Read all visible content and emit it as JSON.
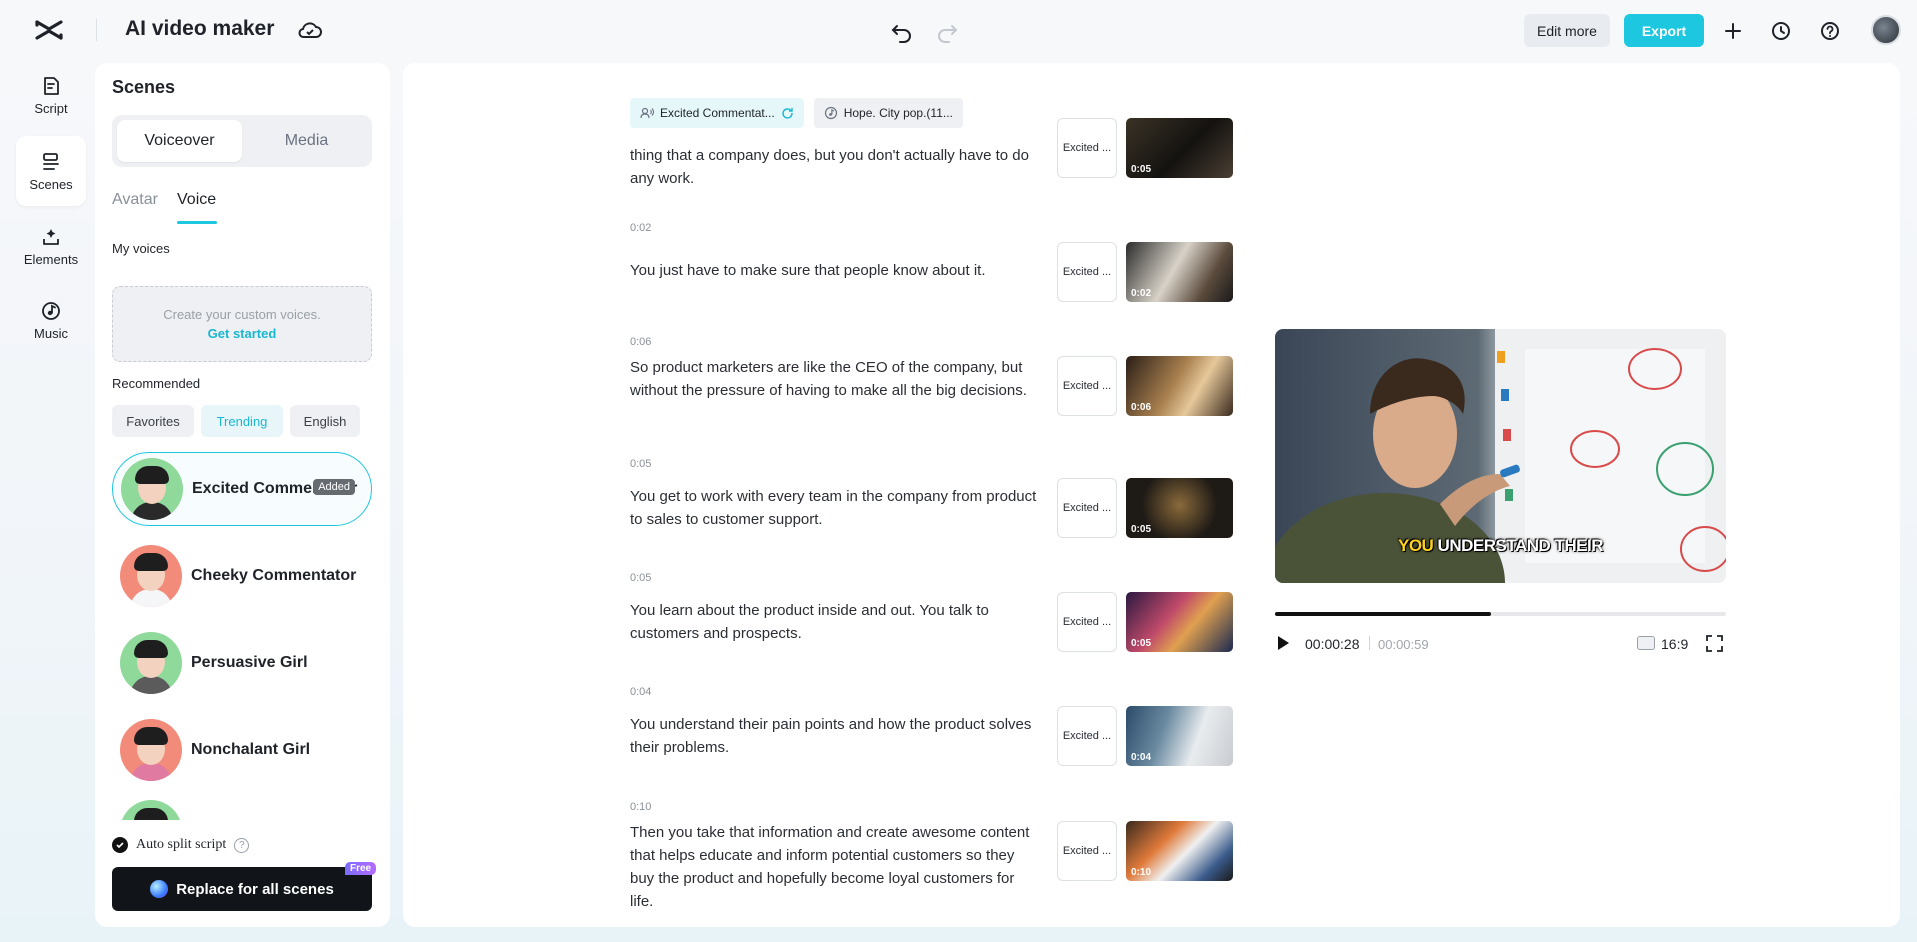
{
  "app": {
    "title": "AI video maker",
    "edit_more": "Edit more",
    "export": "Export",
    "accent": "#1ec7e0"
  },
  "rail": [
    {
      "label": "Script",
      "icon": "script-icon"
    },
    {
      "label": "Scenes",
      "icon": "scenes-icon"
    },
    {
      "label": "Elements",
      "icon": "elements-icon"
    },
    {
      "label": "Music",
      "icon": "music-icon"
    }
  ],
  "scenes_panel": {
    "title": "Scenes",
    "segment": [
      "Voiceover",
      "Media"
    ],
    "tabs": [
      "Avatar",
      "Voice"
    ],
    "my_voices": "My voices",
    "custom_text": "Create your custom voices.",
    "get_started": "Get started",
    "recommended": "Recommended",
    "filters": [
      "Favorites",
      "Trending",
      "English"
    ],
    "voices": [
      {
        "name": "Excited Commentator",
        "badge": "Added"
      },
      {
        "name": "Cheeky Commentator"
      },
      {
        "name": "Persuasive Girl"
      },
      {
        "name": "Nonchalant Girl"
      }
    ],
    "auto_split": "Auto split script",
    "replace_btn": "Replace for all scenes",
    "free": "Free"
  },
  "main": {
    "voice_chip": "Excited Commentat...",
    "music_chip": "Hope. City pop.(11...",
    "scenes": [
      {
        "time": "",
        "text": "thing that a company does, but you don't actually have to do any work.",
        "voice": "Excited ...",
        "dur": "0:05"
      },
      {
        "time": "0:02",
        "text": "You just have to make sure that people know about it.",
        "voice": "Excited ...",
        "dur": "0:02"
      },
      {
        "time": "0:06",
        "text": "So product marketers are like the CEO of the company, but without the pressure of having to make all the big decisions.",
        "voice": "Excited ...",
        "dur": "0:06"
      },
      {
        "time": "0:05",
        "text": "You get to work with every team in the company from product to sales to customer support.",
        "voice": "Excited ...",
        "dur": "0:05"
      },
      {
        "time": "0:05",
        "text": "You learn about the product inside and out. You talk to customers and prospects.",
        "voice": "Excited ...",
        "dur": "0:05"
      },
      {
        "time": "0:04",
        "text": "You understand their pain points and how the product solves their problems.",
        "voice": "Excited ...",
        "dur": "0:04"
      },
      {
        "time": "0:10",
        "text": "Then you take that information and create awesome content that helps educate and inform potential customers so they buy the product and hopefully become loyal customers for life.",
        "voice": "Excited ...",
        "dur": "0:10"
      }
    ]
  },
  "preview": {
    "caption_highlight": "YOU",
    "caption_rest": " UNDERSTAND THEIR",
    "current_time": "00:00:28",
    "total_time": "00:00:59",
    "progress": 0.48,
    "aspect": "16:9"
  }
}
